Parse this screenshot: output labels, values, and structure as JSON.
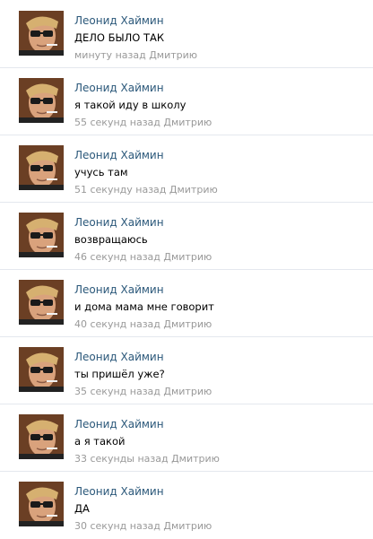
{
  "messages": [
    {
      "author": "Леонид Хаймин",
      "text": "ДЕЛО БЫЛО ТАК",
      "time": "минуту назад Дмитрию"
    },
    {
      "author": "Леонид Хаймин",
      "text": "я такой иду в школу",
      "time": "55 секунд назад Дмитрию"
    },
    {
      "author": "Леонид Хаймин",
      "text": "учусь там",
      "time": "51 секунду назад Дмитрию"
    },
    {
      "author": "Леонид Хаймин",
      "text": "возвращаюсь",
      "time": "46 секунд назад Дмитрию"
    },
    {
      "author": "Леонид Хаймин",
      "text": "и дома мама мне говорит",
      "time": "40 секунд назад Дмитрию"
    },
    {
      "author": "Леонид Хаймин",
      "text": "ты пришёл уже?",
      "time": "35 секунд назад Дмитрию"
    },
    {
      "author": "Леонид Хаймин",
      "text": "а я такой",
      "time": "33 секунды назад Дмитрию"
    },
    {
      "author": "Леонид Хаймин",
      "text": "ДА",
      "time": "30 секунд назад Дмитрию"
    }
  ]
}
